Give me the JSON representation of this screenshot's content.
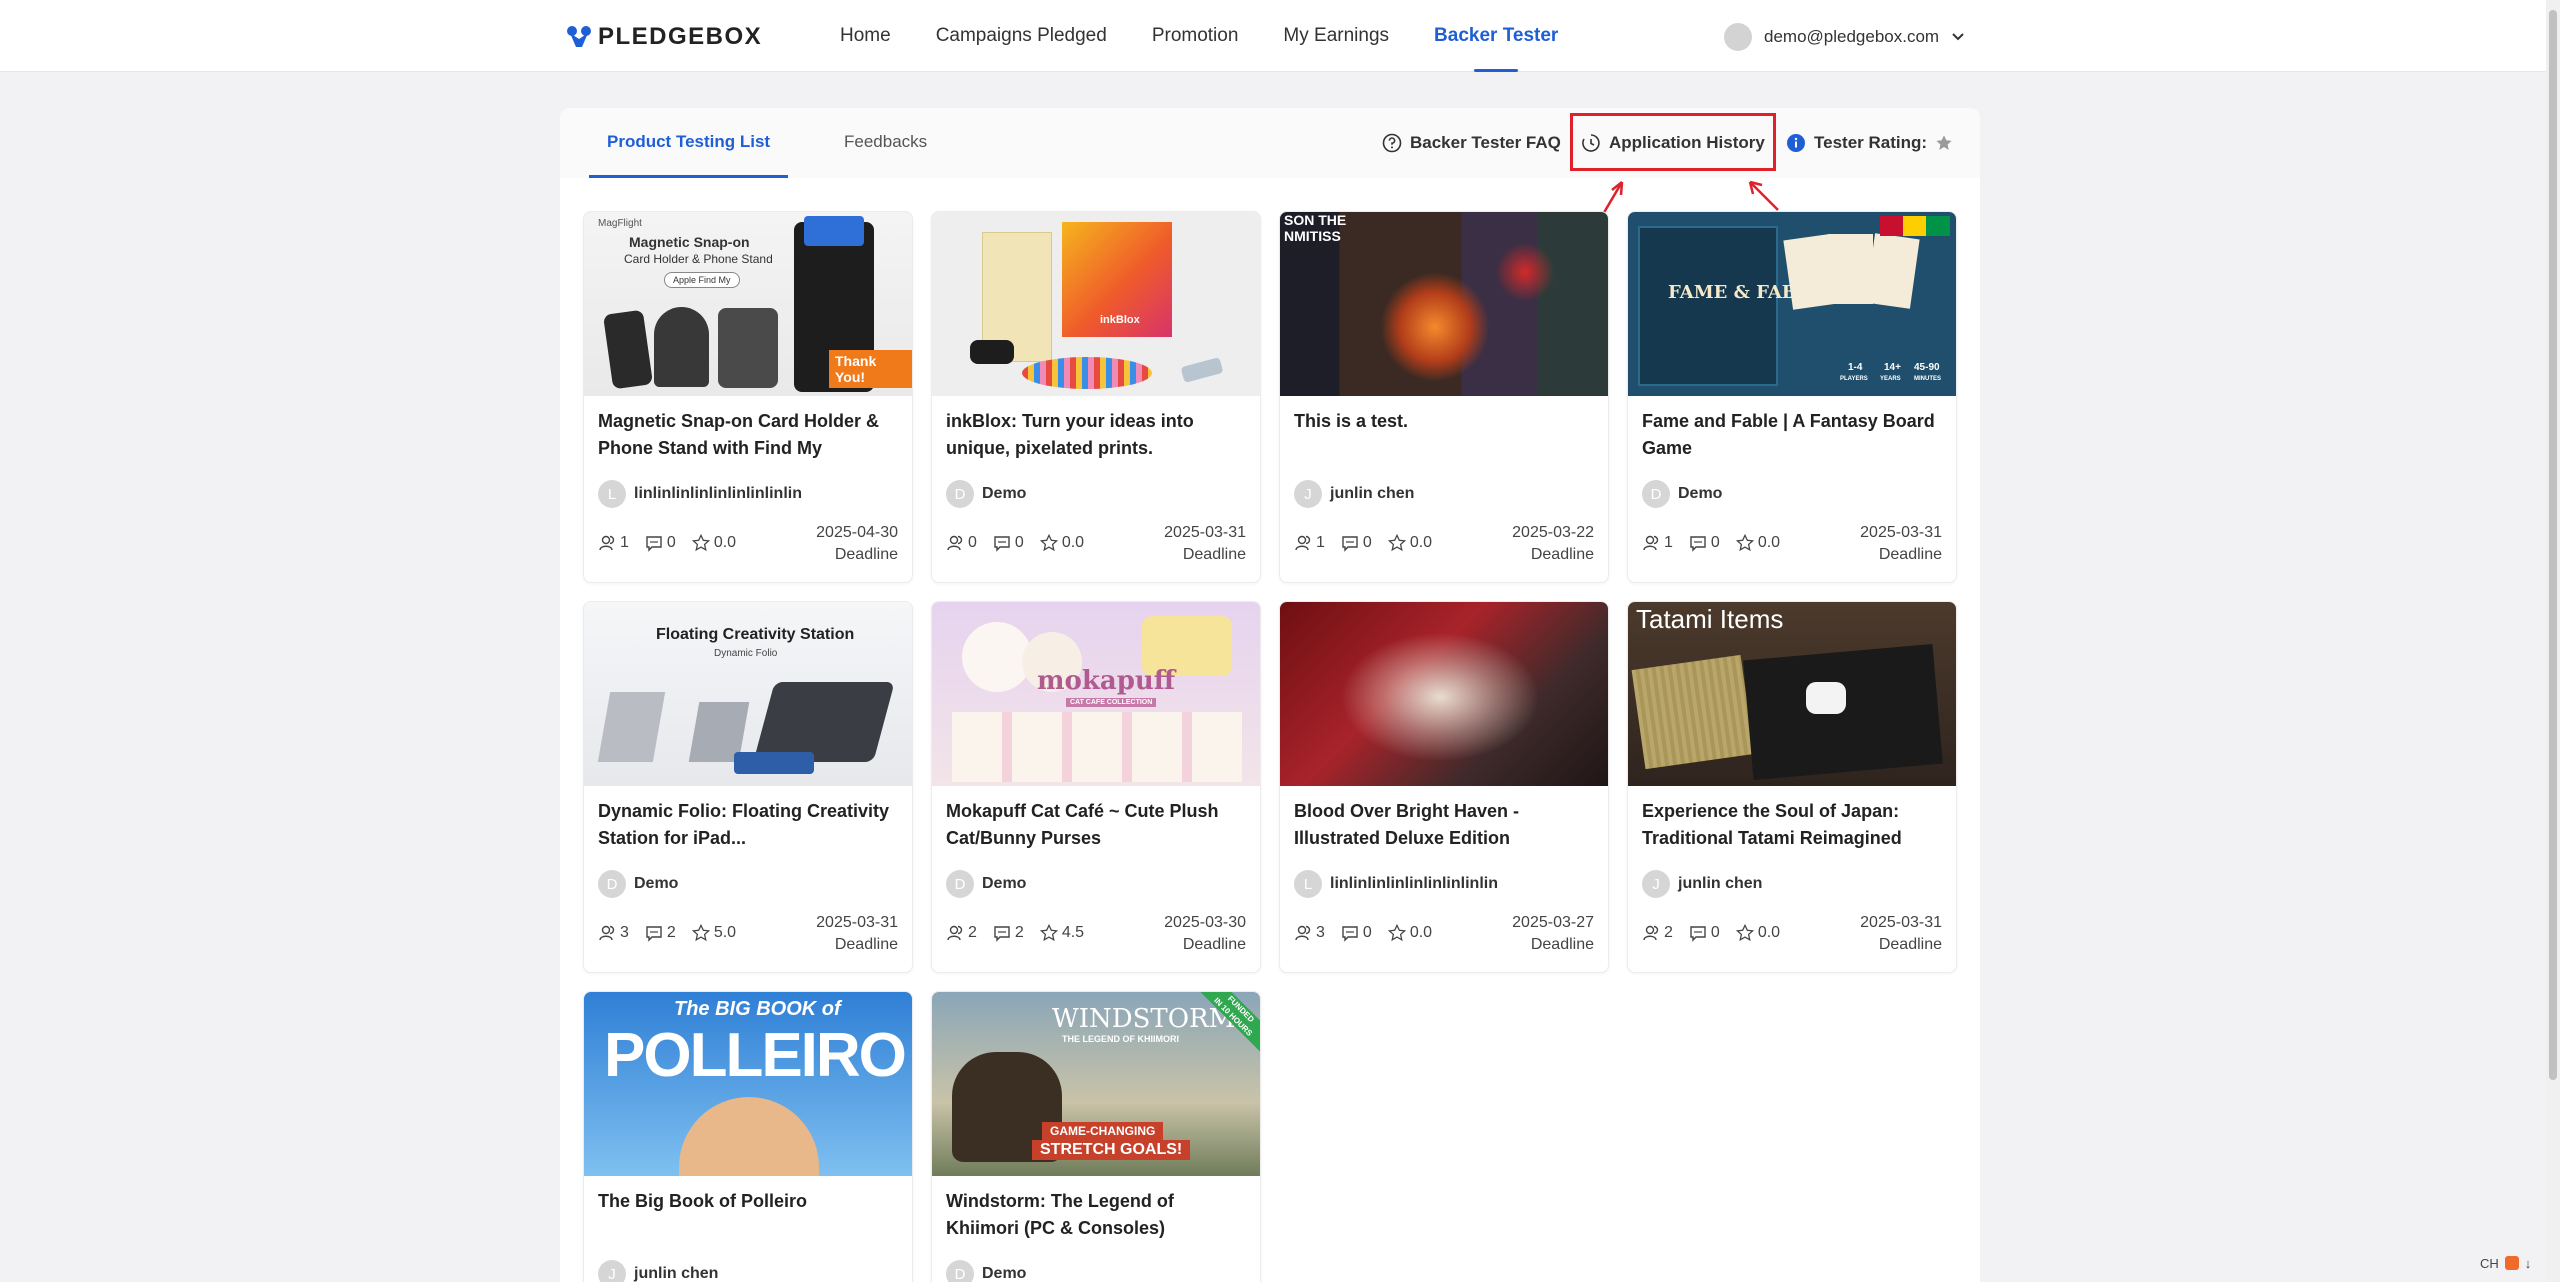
{
  "brand": {
    "name": "PLEDGEBOX",
    "accent": "#1f5fd6",
    "highlight": "#e0202a"
  },
  "nav": [
    {
      "label": "Home"
    },
    {
      "label": "Campaigns Pledged"
    },
    {
      "label": "Promotion"
    },
    {
      "label": "My Earnings"
    },
    {
      "label": "Backer Tester",
      "active": true
    }
  ],
  "user": {
    "email": "demo@pledgebox.com"
  },
  "tabs": {
    "list": "Product Testing List",
    "feedbacks": "Feedbacks"
  },
  "actions": {
    "faq": "Backer Tester FAQ",
    "history": "Application History",
    "rating": "Tester Rating:"
  },
  "deadline_label": "Deadline",
  "thumbs": {
    "p1_title": "Magnetic Snap-on",
    "p1_sub": "Card Holder & Phone Stand",
    "p1_badge": "Thank You!",
    "p1_brand": "MagFlight",
    "p1_findmy": "Apple Find My",
    "p2_brand": "inkBlox",
    "p3_text": "SON THE NMITISS",
    "p4_title": "FAME & FABLE",
    "p4_players": "1-4",
    "p4_age": "14+",
    "p4_time": "45-90",
    "p4_players_l": "PLAYERS",
    "p4_age_l": "YEARS",
    "p4_time_l": "MINUTES",
    "p5_title": "Floating Creativity Station",
    "p5_sub": "Dynamic Folio",
    "p6_title": "mokapuff",
    "p6_sub": "CAT CAFE COLLECTION",
    "p8_title": "Tatami Items",
    "p9_top": "The BIG BOOK of",
    "p9_title": "POLLEIRO",
    "p10_title": "WINDSTORM",
    "p10_sub": "THE LEGEND OF KHIIMORI",
    "p10_stretch1": "GAME-CHANGING",
    "p10_stretch2": "STRETCH GOALS!",
    "p10_ribbon1": "FUNDED",
    "p10_ribbon2": "IN 10 HOURS"
  },
  "products": [
    {
      "title": "Magnetic Snap-on Card Holder & Phone Stand with Find My",
      "creator": "linlinlinlinlinlinlinlinlin",
      "initial": "L",
      "testers": "1",
      "comments": "0",
      "rating": "0.0",
      "date": "2025-04-30"
    },
    {
      "title": "inkBlox: Turn your ideas into unique, pixelated prints.",
      "creator": "Demo",
      "initial": "D",
      "testers": "0",
      "comments": "0",
      "rating": "0.0",
      "date": "2025-03-31"
    },
    {
      "title": "This is a test.",
      "creator": "junlin chen",
      "initial": "J",
      "testers": "1",
      "comments": "0",
      "rating": "0.0",
      "date": "2025-03-22"
    },
    {
      "title": "Fame and Fable | A Fantasy Board Game",
      "creator": "Demo",
      "initial": "D",
      "testers": "1",
      "comments": "0",
      "rating": "0.0",
      "date": "2025-03-31"
    },
    {
      "title": "Dynamic Folio: Floating Creativity Station for iPad...",
      "creator": "Demo",
      "initial": "D",
      "testers": "3",
      "comments": "2",
      "rating": "5.0",
      "date": "2025-03-31"
    },
    {
      "title": "Mokapuff Cat Café ~ Cute Plush Cat/Bunny Purses",
      "creator": "Demo",
      "initial": "D",
      "testers": "2",
      "comments": "2",
      "rating": "4.5",
      "date": "2025-03-30"
    },
    {
      "title": "Blood Over Bright Haven - Illustrated Deluxe Edition",
      "creator": "linlinlinlinlinlinlinlinlin",
      "initial": "L",
      "testers": "3",
      "comments": "0",
      "rating": "0.0",
      "date": "2025-03-27"
    },
    {
      "title": "Experience the Soul of Japan: Traditional Tatami Reimagined",
      "creator": "junlin chen",
      "initial": "J",
      "testers": "2",
      "comments": "0",
      "rating": "0.0",
      "date": "2025-03-31"
    },
    {
      "title": "The Big Book of Polleiro",
      "creator": "junlin chen",
      "initial": "J"
    },
    {
      "title": "Windstorm: The Legend of Khiimori (PC & Consoles)",
      "creator": "Demo",
      "initial": "D"
    }
  ],
  "ime": {
    "lang": "CH",
    "arrow": "↓"
  }
}
